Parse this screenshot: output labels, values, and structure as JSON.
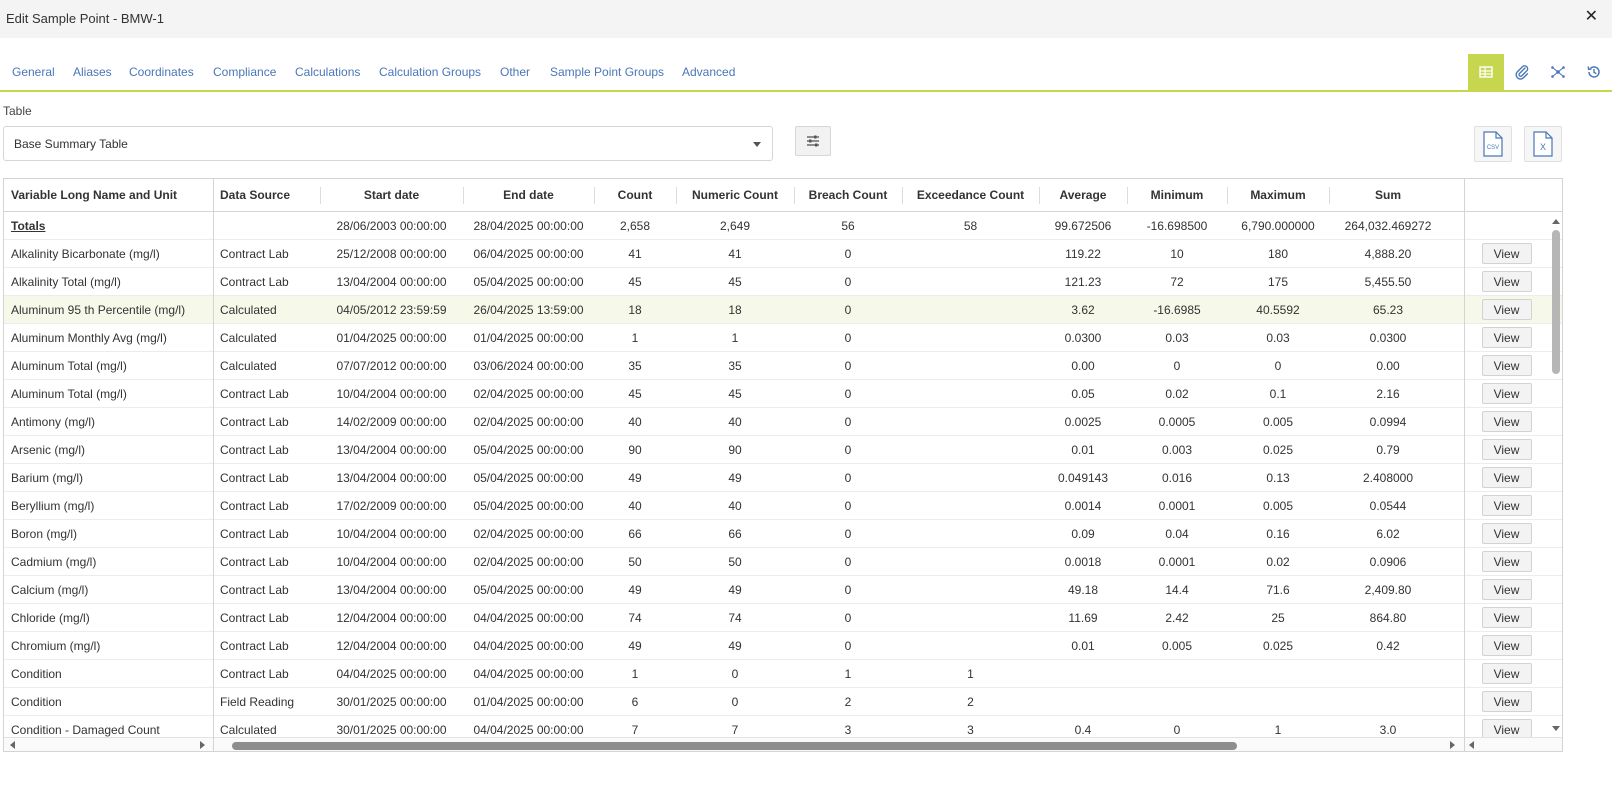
{
  "window": {
    "title": "Edit Sample Point - BMW-1",
    "close_symbol": "✕"
  },
  "tabs": [
    {
      "label": "General"
    },
    {
      "label": "Aliases"
    },
    {
      "label": "Coordinates"
    },
    {
      "label": "Compliance"
    },
    {
      "label": "Calculations"
    },
    {
      "label": "Calculation Groups"
    },
    {
      "label": "Other"
    },
    {
      "label": "Sample Point Groups"
    },
    {
      "label": "Advanced"
    }
  ],
  "tab_icons": [
    {
      "name": "table-icon",
      "active": true
    },
    {
      "name": "paperclip-icon",
      "active": false
    },
    {
      "name": "network-icon",
      "active": false
    },
    {
      "name": "history-icon",
      "active": false
    }
  ],
  "table_selector": {
    "label": "Table",
    "selected": "Base Summary Table"
  },
  "exports": [
    {
      "name": "csv-export-icon",
      "label": "CSV"
    },
    {
      "name": "excel-export-icon",
      "label": "X"
    }
  ],
  "colors": {
    "accent": "#c7d64f",
    "link": "#4a76b8",
    "highlight_row": "#f6f9e9"
  },
  "grid": {
    "columns": [
      "Variable Long Name and Unit",
      "Data Source",
      "Start date",
      "End date",
      "Count",
      "Numeric Count",
      "Breach Count",
      "Exceedance Count",
      "Average",
      "Minimum",
      "Maximum",
      "Sum"
    ],
    "totals": [
      "Totals",
      "",
      "28/06/2003 00:00:00",
      "28/04/2025 00:00:00",
      "2,658",
      "2,649",
      "56",
      "58",
      "99.672506",
      "-16.698500",
      "6,790.000000",
      "264,032.469272"
    ],
    "view_label": "View",
    "highlighted_row": 2,
    "rows": [
      [
        "Alkalinity Bicarbonate (mg/l)",
        "Contract Lab",
        "25/12/2008 00:00:00",
        "06/04/2025 00:00:00",
        "41",
        "41",
        "0",
        "",
        "119.22",
        "10",
        "180",
        "4,888.20"
      ],
      [
        "Alkalinity Total (mg/l)",
        "Contract Lab",
        "13/04/2004 00:00:00",
        "05/04/2025 00:00:00",
        "45",
        "45",
        "0",
        "",
        "121.23",
        "72",
        "175",
        "5,455.50"
      ],
      [
        "Aluminum 95 th Percentile (mg/l)",
        "Calculated",
        "04/05/2012 23:59:59",
        "26/04/2025 13:59:00",
        "18",
        "18",
        "0",
        "",
        "3.62",
        "-16.6985",
        "40.5592",
        "65.23"
      ],
      [
        "Aluminum Monthly Avg (mg/l)",
        "Calculated",
        "01/04/2025 00:00:00",
        "01/04/2025 00:00:00",
        "1",
        "1",
        "0",
        "",
        "0.0300",
        "0.03",
        "0.03",
        "0.0300"
      ],
      [
        "Aluminum Total (mg/l)",
        "Calculated",
        "07/07/2012 00:00:00",
        "03/06/2024 00:00:00",
        "35",
        "35",
        "0",
        "",
        "0.00",
        "0",
        "0",
        "0.00"
      ],
      [
        "Aluminum Total (mg/l)",
        "Contract Lab",
        "10/04/2004 00:00:00",
        "02/04/2025 00:00:00",
        "45",
        "45",
        "0",
        "",
        "0.05",
        "0.02",
        "0.1",
        "2.16"
      ],
      [
        "Antimony (mg/l)",
        "Contract Lab",
        "14/02/2009 00:00:00",
        "02/04/2025 00:00:00",
        "40",
        "40",
        "0",
        "",
        "0.0025",
        "0.0005",
        "0.005",
        "0.0994"
      ],
      [
        "Arsenic (mg/l)",
        "Contract Lab",
        "13/04/2004 00:00:00",
        "05/04/2025 00:00:00",
        "90",
        "90",
        "0",
        "",
        "0.01",
        "0.003",
        "0.025",
        "0.79"
      ],
      [
        "Barium (mg/l)",
        "Contract Lab",
        "13/04/2004 00:00:00",
        "05/04/2025 00:00:00",
        "49",
        "49",
        "0",
        "",
        "0.049143",
        "0.016",
        "0.13",
        "2.408000"
      ],
      [
        "Beryllium (mg/l)",
        "Contract Lab",
        "17/02/2009 00:00:00",
        "05/04/2025 00:00:00",
        "40",
        "40",
        "0",
        "",
        "0.0014",
        "0.0001",
        "0.005",
        "0.0544"
      ],
      [
        "Boron (mg/l)",
        "Contract Lab",
        "10/04/2004 00:00:00",
        "02/04/2025 00:00:00",
        "66",
        "66",
        "0",
        "",
        "0.09",
        "0.04",
        "0.16",
        "6.02"
      ],
      [
        "Cadmium (mg/l)",
        "Contract Lab",
        "10/04/2004 00:00:00",
        "02/04/2025 00:00:00",
        "50",
        "50",
        "0",
        "",
        "0.0018",
        "0.0001",
        "0.02",
        "0.0906"
      ],
      [
        "Calcium (mg/l)",
        "Contract Lab",
        "13/04/2004 00:00:00",
        "05/04/2025 00:00:00",
        "49",
        "49",
        "0",
        "",
        "49.18",
        "14.4",
        "71.6",
        "2,409.80"
      ],
      [
        "Chloride (mg/l)",
        "Contract Lab",
        "12/04/2004 00:00:00",
        "04/04/2025 00:00:00",
        "74",
        "74",
        "0",
        "",
        "11.69",
        "2.42",
        "25",
        "864.80"
      ],
      [
        "Chromium (mg/l)",
        "Contract Lab",
        "12/04/2004 00:00:00",
        "04/04/2025 00:00:00",
        "49",
        "49",
        "0",
        "",
        "0.01",
        "0.005",
        "0.025",
        "0.42"
      ],
      [
        "Condition",
        "Contract Lab",
        "04/04/2025 00:00:00",
        "04/04/2025 00:00:00",
        "1",
        "0",
        "1",
        "1",
        "",
        "",
        "",
        ""
      ],
      [
        "Condition",
        "Field Reading",
        "30/01/2025 00:00:00",
        "01/04/2025 00:00:00",
        "6",
        "0",
        "2",
        "2",
        "",
        "",
        "",
        ""
      ],
      [
        "Condition - Damaged Count",
        "Calculated",
        "30/01/2025 00:00:00",
        "04/04/2025 00:00:00",
        "7",
        "7",
        "3",
        "3",
        "0.4",
        "0",
        "1",
        "3.0"
      ]
    ]
  }
}
